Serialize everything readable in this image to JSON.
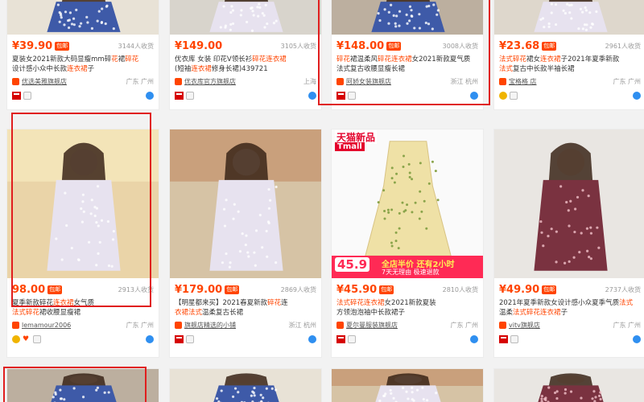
{
  "colors": {
    "accent": "#ff4400",
    "tmall_red": "#d60000",
    "box_red": "#e01e1e",
    "blue": "#2f8ff0"
  },
  "cards": [
    {
      "id": "r1c1",
      "price": "¥39.90",
      "badge": "包邮",
      "sales": "3144人收货",
      "title_parts": [
        [
          "夏装女2021新款大码显瘦mm碎",
          false
        ],
        [
          "花",
          true
        ],
        [
          "裙",
          false
        ],
        [
          "碎花",
          true
        ],
        [
          "\n",
          false
        ],
        [
          "设计",
          false
        ],
        [
          "感",
          false
        ],
        [
          "小众",
          false
        ],
        [
          "中长款",
          false
        ],
        [
          "连衣裙",
          true
        ],
        [
          "子",
          false
        ]
      ],
      "shop": "优选美雅旗舰店",
      "loc": "广东 广州",
      "icons": "tm"
    },
    {
      "id": "r1c2",
      "price": "¥149.00",
      "badge": "",
      "sales": "3105人收货",
      "title_parts": [
        [
          "优衣库 女装 印花V领长衫",
          false
        ],
        [
          "碎花",
          true
        ],
        [
          "连衣裙",
          true
        ],
        [
          "\n",
          false
        ],
        [
          "(短袖",
          false
        ],
        [
          "连衣裙",
          true
        ],
        [
          "修身长裙)439721",
          false
        ]
      ],
      "shop": "优衣库官方旗舰店",
      "loc": "上海",
      "icons": "tm"
    },
    {
      "id": "r1c3",
      "price": "¥148.00",
      "badge": "包邮",
      "sales": "3008人收货",
      "title_parts": [
        [
          "碎花",
          true
        ],
        [
          "裙",
          false
        ],
        [
          "温柔风",
          false
        ],
        [
          "碎花",
          true
        ],
        [
          "连衣裙",
          true
        ],
        [
          "女2021新款夏气质",
          false
        ],
        [
          "\n",
          false
        ],
        [
          "法式",
          false
        ],
        [
          "复古",
          false
        ],
        [
          "收腰显瘦",
          false
        ],
        [
          "长裙",
          false
        ]
      ],
      "shop": "阿娇女装旗舰店",
      "loc": "浙江 杭州",
      "icons": "tm"
    },
    {
      "id": "r1c4",
      "price": "¥23.68",
      "badge": "包邮",
      "sales": "2961人收货",
      "title_parts": [
        [
          "法式",
          true
        ],
        [
          "碎花",
          true
        ],
        [
          "裙女",
          false
        ],
        [
          "连衣裙",
          true
        ],
        [
          "子2021年夏季新款",
          false
        ],
        [
          "\n",
          false
        ],
        [
          "法式",
          true
        ],
        [
          "复古",
          false
        ],
        [
          "中长",
          false
        ],
        [
          "款",
          false
        ],
        [
          "半袖",
          false
        ],
        [
          "长裙",
          false
        ]
      ],
      "shop": "宝格格 店",
      "loc": "广东 广州",
      "icons": "gold"
    },
    {
      "id": "r2c1",
      "price": "98.00",
      "badge": "包邮",
      "sales": "2913人收货",
      "title_parts": [
        [
          "夏季新款碎花",
          false
        ],
        [
          "连衣裙",
          true
        ],
        [
          "女气质",
          false
        ],
        [
          "\n",
          false
        ],
        [
          "法式",
          true
        ],
        [
          "碎花",
          true
        ],
        [
          "裙",
          false
        ],
        [
          "收腰",
          false
        ],
        [
          "显瘦",
          false
        ],
        [
          "裙",
          false
        ]
      ],
      "shop": "lemamour2006",
      "loc": "广东 广州",
      "icons": "gold-heart"
    },
    {
      "id": "r2c2",
      "price": "¥179.00",
      "badge": "包邮",
      "sales": "2869人收货",
      "title_parts": [
        [
          "【明星都来买】2021春夏新款",
          false
        ],
        [
          "碎花",
          true
        ],
        [
          "连",
          false
        ],
        [
          "\n",
          false
        ],
        [
          "衣裙",
          true
        ],
        [
          "法式",
          true
        ],
        [
          "温柔",
          false
        ],
        [
          "复古",
          false
        ],
        [
          "长裙",
          false
        ]
      ],
      "shop": "旗舰店精选的小铺",
      "loc": "浙江 杭州",
      "icons": "tm"
    },
    {
      "id": "r2c3",
      "price": "¥45.90",
      "badge": "包邮",
      "sales": "2810人收货",
      "title_parts": [
        [
          "法式",
          true
        ],
        [
          "碎花",
          true
        ],
        [
          "连衣裙",
          true
        ],
        [
          "女2021新款夏装",
          false
        ],
        [
          "\n",
          false
        ],
        [
          "方领",
          false
        ],
        [
          "泡泡袖",
          false
        ],
        [
          "中长款",
          false
        ],
        [
          "裙子",
          false
        ]
      ],
      "shop": "夏尔曼服装旗舰店",
      "loc": "广东 广州",
      "icons": "tm",
      "tmall_banner": [
        "天猫新品",
        "Tmall"
      ],
      "promo": {
        "price": "45.9",
        "line1": "全店半价 还有2小时",
        "line2": "7天无理由 极速退款"
      }
    },
    {
      "id": "r2c4",
      "price": "¥49.90",
      "badge": "包邮",
      "sales": "2737人收货",
      "title_parts": [
        [
          "2021年夏季新款女设计感小众夏季气质",
          false
        ],
        [
          "法式",
          true
        ],
        [
          "\n",
          false
        ],
        [
          "温柔",
          false
        ],
        [
          "法式",
          true
        ],
        [
          "碎花",
          true
        ],
        [
          "连衣裙",
          true
        ],
        [
          "子",
          false
        ]
      ],
      "shop": "vitv旗舰店",
      "loc": "广东 广州",
      "icons": "tm"
    }
  ]
}
